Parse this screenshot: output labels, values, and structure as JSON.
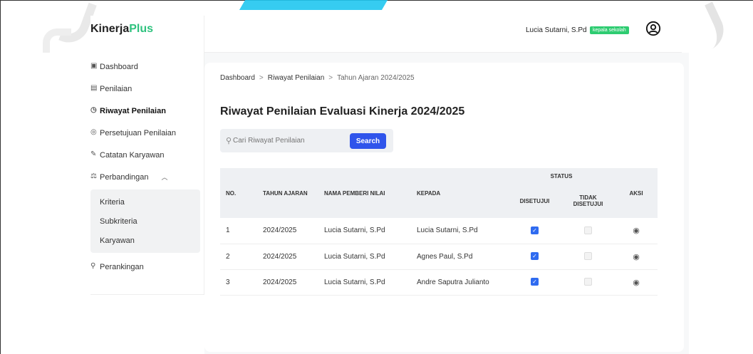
{
  "brand": {
    "name_part1": "Kinerja",
    "name_part2": "Plus"
  },
  "header": {
    "user_name": "Lucia Sutarni, S.Pd",
    "role_badge": "kepala sekolah",
    "user_icon": "user-circle-icon"
  },
  "sidebar": {
    "items": [
      {
        "label": "Dashboard",
        "icon": "dashboard-icon"
      },
      {
        "label": "Penilaian",
        "icon": "clipboard-icon"
      },
      {
        "label": "Riwayat Penilaian",
        "icon": "clock-icon",
        "active": true
      },
      {
        "label": "Persetujuan Penilaian",
        "icon": "check-circle-icon"
      },
      {
        "label": "Catatan Karyawan",
        "icon": "notes-icon"
      },
      {
        "label": "Perbandingan",
        "icon": "scale-icon",
        "expanded": true
      },
      {
        "label": "Perankingan",
        "icon": "hierarchy-icon"
      }
    ],
    "submenu": [
      "Kriteria",
      "Subkriteria",
      "Karyawan"
    ]
  },
  "breadcrumb": [
    "Dashboard",
    "Riwayat Penilaian",
    "Tahun Ajaran 2024/2025"
  ],
  "page_title": "Riwayat Penilaian Evaluasi Kinerja 2024/2025",
  "search": {
    "placeholder": "Cari Riwayat Penilaian",
    "button": "Search"
  },
  "table": {
    "headers": {
      "no": "NO.",
      "tahun": "TAHUN AJARAN",
      "pemberi": "NAMA PEMBERI NILAI",
      "kepada": "KEPADA",
      "status": "STATUS",
      "disetujui": "DISETUJUI",
      "tidak": "TIDAK DISETUJUI",
      "aksi": "AKSI"
    },
    "rows": [
      {
        "no": "1",
        "tahun": "2024/2025",
        "pemberi": "Lucia Sutarni, S.Pd",
        "kepada": "Lucia Sutarni, S.Pd",
        "disetujui": true,
        "tidak_disetujui": false
      },
      {
        "no": "2",
        "tahun": "2024/2025",
        "pemberi": "Lucia Sutarni, S.Pd",
        "kepada": "Agnes Paul, S.Pd",
        "disetujui": true,
        "tidak_disetujui": false
      },
      {
        "no": "3",
        "tahun": "2024/2025",
        "pemberi": "Lucia Sutarni, S.Pd",
        "kepada": "Andre Saputra Julianto",
        "disetujui": true,
        "tidak_disetujui": false
      }
    ]
  },
  "colors": {
    "accent": "#2f54eb",
    "brand_green": "#2ec27e",
    "badge_green": "#2ecc71",
    "checkbox_blue": "#2f6bf0"
  }
}
